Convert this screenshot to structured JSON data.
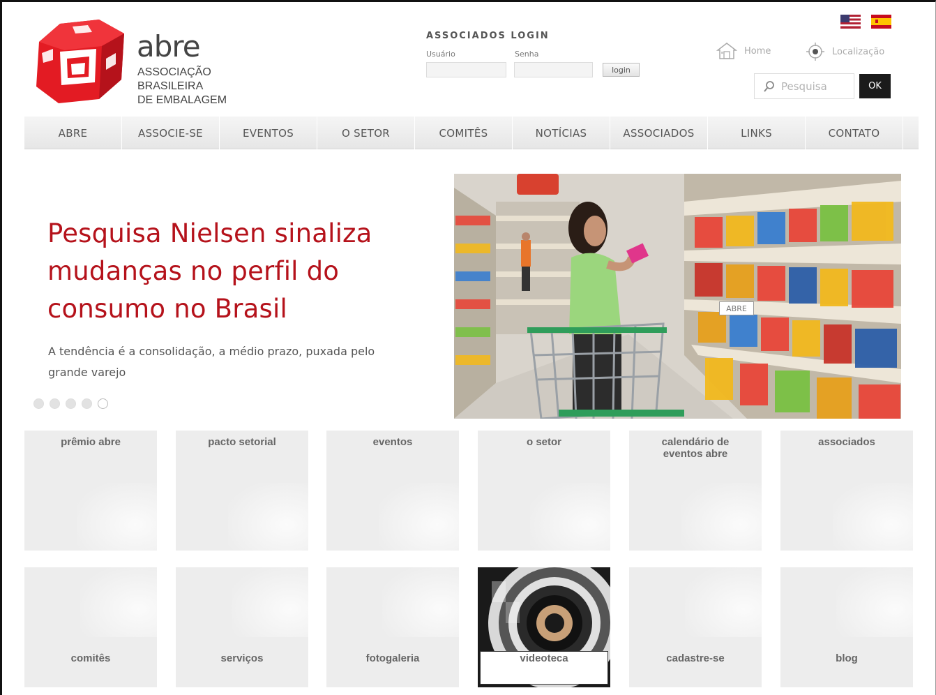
{
  "brand": {
    "name": "abre",
    "subtitle": [
      "ASSOCIAÇÃO",
      "BRASILEIRA",
      "DE EMBALAGEM"
    ],
    "color": "#e31b23"
  },
  "login": {
    "title": "ASSOCIADOS LOGIN",
    "user_label": "Usuário",
    "password_label": "Senha",
    "button": "login"
  },
  "utility": {
    "home": "Home",
    "location": "Localização"
  },
  "search": {
    "placeholder": "Pesquisa",
    "button": "OK"
  },
  "nav": [
    "ABRE",
    "ASSOCIE-SE",
    "EVENTOS",
    "O SETOR",
    "COMITÊS",
    "NOTÍCIAS",
    "ASSOCIADOS",
    "LINKS",
    "CONTATO"
  ],
  "hero": {
    "title": "Pesquisa Nielsen sinaliza mudanças no perfil do consumo no Brasil",
    "subtitle": "A tendência é a consolidação, a médio prazo, puxada pelo grande varejo",
    "badge": "ABRE",
    "slides": 5,
    "active_slide": 5,
    "title_color": "#b5121b"
  },
  "tiles_top": [
    "prêmio abre",
    "pacto setorial",
    "eventos",
    "o setor",
    "calendário de\neventos abre",
    "associados"
  ],
  "tiles_bottom": [
    "comitês",
    "serviços",
    "fotogaleria",
    "videoteca",
    "cadastre-se",
    "blog"
  ]
}
